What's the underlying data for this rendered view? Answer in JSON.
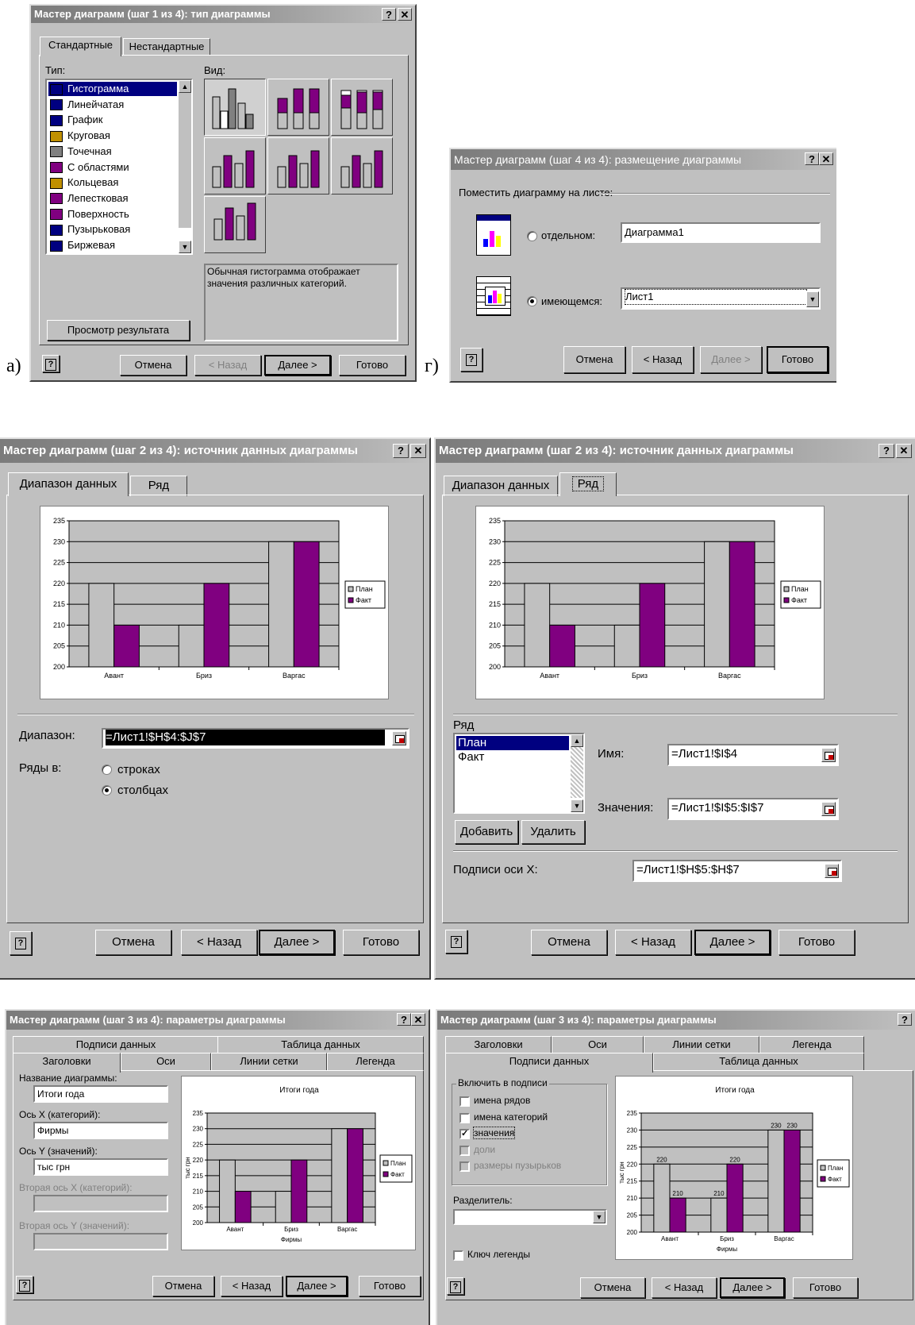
{
  "captions": {
    "a": "а)",
    "g": "г)"
  },
  "colors": {
    "plan": "#c0c0c0",
    "fact": "#800080",
    "titlebar": "#7b7b7b"
  },
  "icons": [
    "help-icon",
    "close-icon",
    "question-icon",
    "chart-type-icon",
    "range-select-icon",
    "new-sheet-icon",
    "embed-sheet-icon",
    "dropdown-arrow-icon",
    "scroll-up-icon",
    "scroll-down-icon",
    "checkmark-icon"
  ],
  "step1": {
    "title": "Мастер диаграмм (шаг 1 из 4): тип диаграммы",
    "tabs": [
      "Стандартные",
      "Нестандартные"
    ],
    "type_label": "Тип:",
    "view_label": "Вид:",
    "types": [
      "Гистограмма",
      "Линейчатая",
      "График",
      "Круговая",
      "Точечная",
      "С областями",
      "Кольцевая",
      "Лепестковая",
      "Поверхность",
      "Пузырьковая",
      "Биржевая"
    ],
    "description": "Обычная гистограмма отображает значения различных категорий.",
    "preview_button": "Просмотр результата",
    "buttons": {
      "cancel": "Отмена",
      "back": "< Назад",
      "next": "Далее >",
      "finish": "Готово"
    }
  },
  "step4": {
    "title": "Мастер диаграмм (шаг 4 из 4): размещение диаграммы",
    "group_label": "Поместить диаграмму на листе:",
    "separate_label": "отдельном:",
    "separate_value": "Диаграмма1",
    "existing_label": "имеющемся:",
    "existing_value": "Лист1",
    "buttons": {
      "cancel": "Отмена",
      "back": "< Назад",
      "next": "Далее >",
      "finish": "Готово"
    }
  },
  "step2a": {
    "title": "Мастер диаграмм (шаг 2 из 4): источник данных диаграммы",
    "tabs": [
      "Диапазон данных",
      "Ряд"
    ],
    "range_label": "Диапазон:",
    "range_value": "=Лист1!$H$4:$J$7",
    "series_in_label": "Ряды в:",
    "rows_label": "строках",
    "cols_label": "столбцах",
    "buttons": {
      "cancel": "Отмена",
      "back": "< Назад",
      "next": "Далее >",
      "finish": "Готово"
    }
  },
  "step2b": {
    "title": "Мастер диаграмм (шаг 2 из 4): источник данных диаграммы",
    "tabs": [
      "Диапазон данных",
      "Ряд"
    ],
    "series_label": "Ряд",
    "series_items": [
      "План",
      "Факт"
    ],
    "name_label": "Имя:",
    "name_value": "=Лист1!$I$4",
    "values_label": "Значения:",
    "values_value": "=Лист1!$I$5:$I$7",
    "add_button": "Добавить",
    "remove_button": "Удалить",
    "xlabels_label": "Подписи оси X:",
    "xlabels_value": "=Лист1!$H$5:$H$7",
    "buttons": {
      "cancel": "Отмена",
      "back": "< Назад",
      "next": "Далее >",
      "finish": "Готово"
    }
  },
  "step3a": {
    "title": "Мастер диаграмм (шаг 3 из 4): параметры диаграммы",
    "tabs_back": [
      "Подписи данных",
      "Таблица данных"
    ],
    "tabs_front": [
      "Заголовки",
      "Оси",
      "Линии сетки",
      "Легенда"
    ],
    "chart_title_label": "Название диаграммы:",
    "chart_title_value": "Итоги года",
    "x_axis_label": "Ось X (категорий):",
    "x_axis_value": "Фирмы",
    "y_axis_label": "Ось Y (значений):",
    "y_axis_value": "тыс грн",
    "x2_label": "Вторая ось X (категорий):",
    "y2_label": "Вторая ось Y (значений):",
    "buttons": {
      "cancel": "Отмена",
      "back": "< Назад",
      "next": "Далее >",
      "finish": "Готово"
    }
  },
  "step3b": {
    "title": "Мастер диаграмм (шаг 3 из 4): параметры диаграммы",
    "tabs_back": [
      "Заголовки",
      "Оси",
      "Линии сетки",
      "Легенда"
    ],
    "tabs_front": [
      "Подписи данных",
      "Таблица данных"
    ],
    "group_label": "Включить в подписи",
    "options": [
      "имена рядов",
      "имена категорий",
      "значения",
      "доли",
      "размеры пузырьков"
    ],
    "separator_label": "Разделитель:",
    "legend_key_label": "Ключ легенды",
    "buttons": {
      "cancel": "Отмена",
      "back": "< Назад",
      "next": "Далее >",
      "finish": "Готово"
    }
  },
  "chart_data": [
    {
      "type": "bar",
      "categories": [
        "Авант",
        "Бриз",
        "Варгас"
      ],
      "series": [
        {
          "name": "План",
          "values": [
            220,
            210,
            230
          ]
        },
        {
          "name": "Факт",
          "values": [
            210,
            220,
            230
          ]
        }
      ],
      "ylim": [
        200,
        235
      ],
      "yticks": [
        "200",
        "205",
        "210",
        "215",
        "220",
        "225",
        "230",
        "235"
      ],
      "title": "",
      "xlabel": "",
      "ylabel": "",
      "grid": true,
      "legend": "right"
    },
    {
      "type": "bar",
      "categories": [
        "Авант",
        "Бриз",
        "Варгас"
      ],
      "series": [
        {
          "name": "План",
          "values": [
            220,
            210,
            230
          ]
        },
        {
          "name": "Факт",
          "values": [
            210,
            220,
            230
          ]
        }
      ],
      "ylim": [
        200,
        235
      ],
      "yticks": [
        "200",
        "205",
        "210",
        "215",
        "220",
        "225",
        "230",
        "235"
      ],
      "title": "",
      "xlabel": "",
      "ylabel": "",
      "grid": true,
      "legend": "right"
    },
    {
      "type": "bar",
      "categories": [
        "Авант",
        "Бриз",
        "Варгас"
      ],
      "series": [
        {
          "name": "План",
          "values": [
            220,
            210,
            230
          ]
        },
        {
          "name": "Факт",
          "values": [
            210,
            220,
            230
          ]
        }
      ],
      "ylim": [
        200,
        235
      ],
      "yticks": [
        "200",
        "205",
        "210",
        "215",
        "220",
        "225",
        "230",
        "235"
      ],
      "title": "Итоги года",
      "xlabel": "Фирмы",
      "ylabel": "тыс грн",
      "grid": true,
      "legend": "right"
    },
    {
      "type": "bar",
      "categories": [
        "Авант",
        "Бриз",
        "Варгас"
      ],
      "series": [
        {
          "name": "План",
          "values": [
            220,
            210,
            230
          ]
        },
        {
          "name": "Факт",
          "values": [
            210,
            220,
            230
          ]
        }
      ],
      "ylim": [
        200,
        235
      ],
      "yticks": [
        "200",
        "205",
        "210",
        "215",
        "220",
        "225",
        "230",
        "235"
      ],
      "title": "Итоги года",
      "xlabel": "Фирмы",
      "ylabel": "тыс грн",
      "grid": true,
      "legend": "right",
      "data_labels": true
    }
  ]
}
